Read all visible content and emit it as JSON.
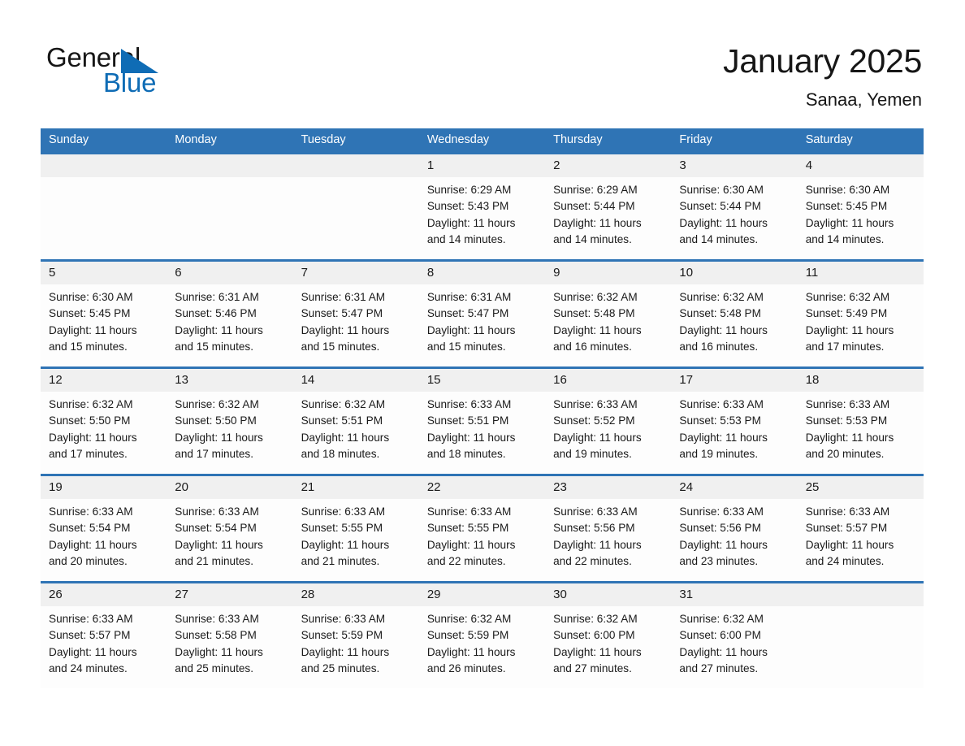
{
  "logo": {
    "word1": "General",
    "word2": "Blue",
    "triangle_color": "#0f6cb5"
  },
  "header": {
    "title": "January 2025",
    "subtitle": "Sanaa, Yemen"
  },
  "theme": {
    "header_blue": "#2f74b5",
    "date_strip_grey": "#f0f0f0",
    "text": "#1a1a1a"
  },
  "weekday_headers": [
    "Sunday",
    "Monday",
    "Tuesday",
    "Wednesday",
    "Thursday",
    "Friday",
    "Saturday"
  ],
  "weeks": [
    [
      {
        "day": "",
        "sunrise": "",
        "sunset": "",
        "daylight_line1": "",
        "daylight_line2": ""
      },
      {
        "day": "",
        "sunrise": "",
        "sunset": "",
        "daylight_line1": "",
        "daylight_line2": ""
      },
      {
        "day": "",
        "sunrise": "",
        "sunset": "",
        "daylight_line1": "",
        "daylight_line2": ""
      },
      {
        "day": "1",
        "sunrise": "Sunrise: 6:29 AM",
        "sunset": "Sunset: 5:43 PM",
        "daylight_line1": "Daylight: 11 hours",
        "daylight_line2": "and 14 minutes."
      },
      {
        "day": "2",
        "sunrise": "Sunrise: 6:29 AM",
        "sunset": "Sunset: 5:44 PM",
        "daylight_line1": "Daylight: 11 hours",
        "daylight_line2": "and 14 minutes."
      },
      {
        "day": "3",
        "sunrise": "Sunrise: 6:30 AM",
        "sunset": "Sunset: 5:44 PM",
        "daylight_line1": "Daylight: 11 hours",
        "daylight_line2": "and 14 minutes."
      },
      {
        "day": "4",
        "sunrise": "Sunrise: 6:30 AM",
        "sunset": "Sunset: 5:45 PM",
        "daylight_line1": "Daylight: 11 hours",
        "daylight_line2": "and 14 minutes."
      }
    ],
    [
      {
        "day": "5",
        "sunrise": "Sunrise: 6:30 AM",
        "sunset": "Sunset: 5:45 PM",
        "daylight_line1": "Daylight: 11 hours",
        "daylight_line2": "and 15 minutes."
      },
      {
        "day": "6",
        "sunrise": "Sunrise: 6:31 AM",
        "sunset": "Sunset: 5:46 PM",
        "daylight_line1": "Daylight: 11 hours",
        "daylight_line2": "and 15 minutes."
      },
      {
        "day": "7",
        "sunrise": "Sunrise: 6:31 AM",
        "sunset": "Sunset: 5:47 PM",
        "daylight_line1": "Daylight: 11 hours",
        "daylight_line2": "and 15 minutes."
      },
      {
        "day": "8",
        "sunrise": "Sunrise: 6:31 AM",
        "sunset": "Sunset: 5:47 PM",
        "daylight_line1": "Daylight: 11 hours",
        "daylight_line2": "and 15 minutes."
      },
      {
        "day": "9",
        "sunrise": "Sunrise: 6:32 AM",
        "sunset": "Sunset: 5:48 PM",
        "daylight_line1": "Daylight: 11 hours",
        "daylight_line2": "and 16 minutes."
      },
      {
        "day": "10",
        "sunrise": "Sunrise: 6:32 AM",
        "sunset": "Sunset: 5:48 PM",
        "daylight_line1": "Daylight: 11 hours",
        "daylight_line2": "and 16 minutes."
      },
      {
        "day": "11",
        "sunrise": "Sunrise: 6:32 AM",
        "sunset": "Sunset: 5:49 PM",
        "daylight_line1": "Daylight: 11 hours",
        "daylight_line2": "and 17 minutes."
      }
    ],
    [
      {
        "day": "12",
        "sunrise": "Sunrise: 6:32 AM",
        "sunset": "Sunset: 5:50 PM",
        "daylight_line1": "Daylight: 11 hours",
        "daylight_line2": "and 17 minutes."
      },
      {
        "day": "13",
        "sunrise": "Sunrise: 6:32 AM",
        "sunset": "Sunset: 5:50 PM",
        "daylight_line1": "Daylight: 11 hours",
        "daylight_line2": "and 17 minutes."
      },
      {
        "day": "14",
        "sunrise": "Sunrise: 6:32 AM",
        "sunset": "Sunset: 5:51 PM",
        "daylight_line1": "Daylight: 11 hours",
        "daylight_line2": "and 18 minutes."
      },
      {
        "day": "15",
        "sunrise": "Sunrise: 6:33 AM",
        "sunset": "Sunset: 5:51 PM",
        "daylight_line1": "Daylight: 11 hours",
        "daylight_line2": "and 18 minutes."
      },
      {
        "day": "16",
        "sunrise": "Sunrise: 6:33 AM",
        "sunset": "Sunset: 5:52 PM",
        "daylight_line1": "Daylight: 11 hours",
        "daylight_line2": "and 19 minutes."
      },
      {
        "day": "17",
        "sunrise": "Sunrise: 6:33 AM",
        "sunset": "Sunset: 5:53 PM",
        "daylight_line1": "Daylight: 11 hours",
        "daylight_line2": "and 19 minutes."
      },
      {
        "day": "18",
        "sunrise": "Sunrise: 6:33 AM",
        "sunset": "Sunset: 5:53 PM",
        "daylight_line1": "Daylight: 11 hours",
        "daylight_line2": "and 20 minutes."
      }
    ],
    [
      {
        "day": "19",
        "sunrise": "Sunrise: 6:33 AM",
        "sunset": "Sunset: 5:54 PM",
        "daylight_line1": "Daylight: 11 hours",
        "daylight_line2": "and 20 minutes."
      },
      {
        "day": "20",
        "sunrise": "Sunrise: 6:33 AM",
        "sunset": "Sunset: 5:54 PM",
        "daylight_line1": "Daylight: 11 hours",
        "daylight_line2": "and 21 minutes."
      },
      {
        "day": "21",
        "sunrise": "Sunrise: 6:33 AM",
        "sunset": "Sunset: 5:55 PM",
        "daylight_line1": "Daylight: 11 hours",
        "daylight_line2": "and 21 minutes."
      },
      {
        "day": "22",
        "sunrise": "Sunrise: 6:33 AM",
        "sunset": "Sunset: 5:55 PM",
        "daylight_line1": "Daylight: 11 hours",
        "daylight_line2": "and 22 minutes."
      },
      {
        "day": "23",
        "sunrise": "Sunrise: 6:33 AM",
        "sunset": "Sunset: 5:56 PM",
        "daylight_line1": "Daylight: 11 hours",
        "daylight_line2": "and 22 minutes."
      },
      {
        "day": "24",
        "sunrise": "Sunrise: 6:33 AM",
        "sunset": "Sunset: 5:56 PM",
        "daylight_line1": "Daylight: 11 hours",
        "daylight_line2": "and 23 minutes."
      },
      {
        "day": "25",
        "sunrise": "Sunrise: 6:33 AM",
        "sunset": "Sunset: 5:57 PM",
        "daylight_line1": "Daylight: 11 hours",
        "daylight_line2": "and 24 minutes."
      }
    ],
    [
      {
        "day": "26",
        "sunrise": "Sunrise: 6:33 AM",
        "sunset": "Sunset: 5:57 PM",
        "daylight_line1": "Daylight: 11 hours",
        "daylight_line2": "and 24 minutes."
      },
      {
        "day": "27",
        "sunrise": "Sunrise: 6:33 AM",
        "sunset": "Sunset: 5:58 PM",
        "daylight_line1": "Daylight: 11 hours",
        "daylight_line2": "and 25 minutes."
      },
      {
        "day": "28",
        "sunrise": "Sunrise: 6:33 AM",
        "sunset": "Sunset: 5:59 PM",
        "daylight_line1": "Daylight: 11 hours",
        "daylight_line2": "and 25 minutes."
      },
      {
        "day": "29",
        "sunrise": "Sunrise: 6:32 AM",
        "sunset": "Sunset: 5:59 PM",
        "daylight_line1": "Daylight: 11 hours",
        "daylight_line2": "and 26 minutes."
      },
      {
        "day": "30",
        "sunrise": "Sunrise: 6:32 AM",
        "sunset": "Sunset: 6:00 PM",
        "daylight_line1": "Daylight: 11 hours",
        "daylight_line2": "and 27 minutes."
      },
      {
        "day": "31",
        "sunrise": "Sunrise: 6:32 AM",
        "sunset": "Sunset: 6:00 PM",
        "daylight_line1": "Daylight: 11 hours",
        "daylight_line2": "and 27 minutes."
      },
      {
        "day": "",
        "sunrise": "",
        "sunset": "",
        "daylight_line1": "",
        "daylight_line2": ""
      }
    ]
  ]
}
